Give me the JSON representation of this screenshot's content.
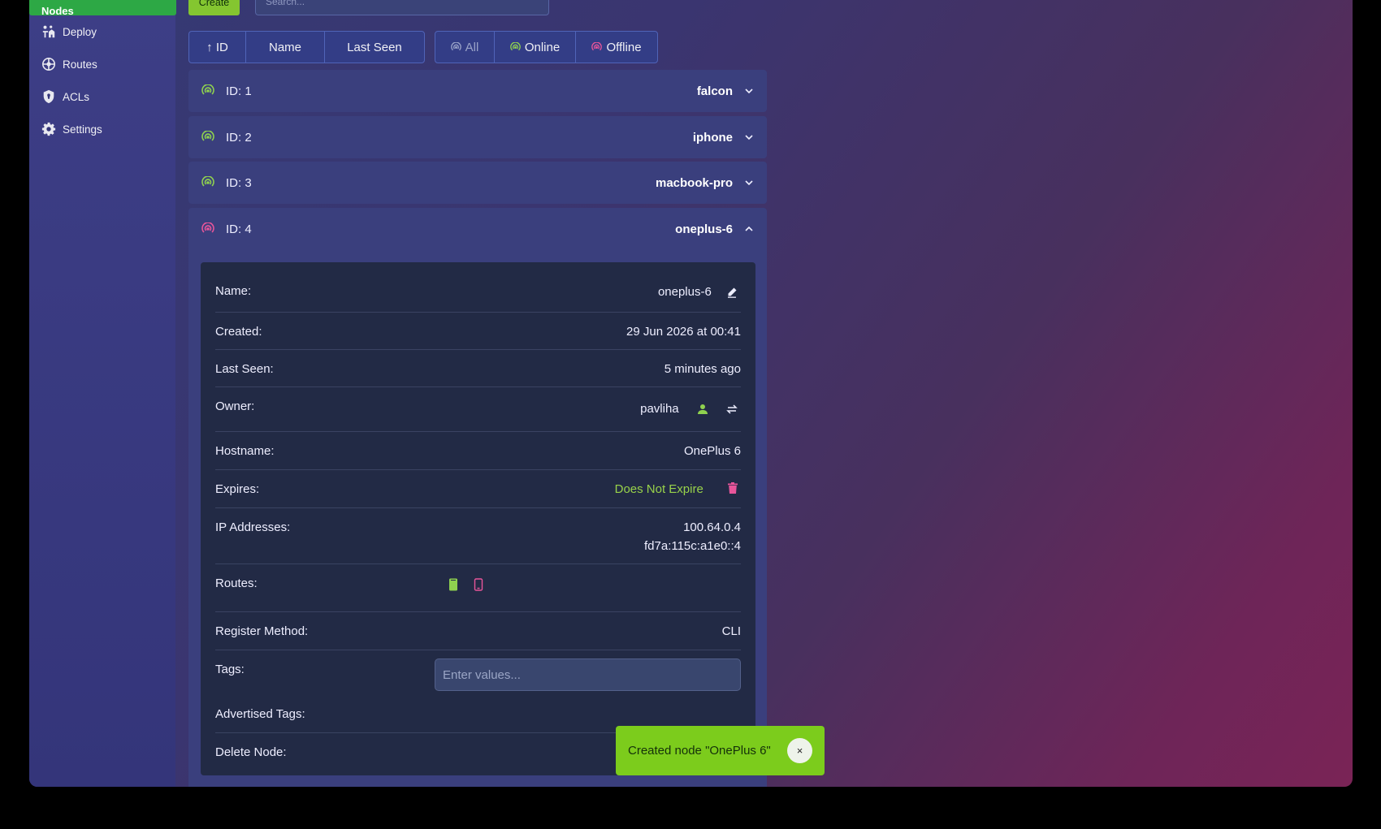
{
  "sidebar": {
    "active_label": "Nodes",
    "items": [
      {
        "label": "Deploy",
        "icon": "deploy-icon"
      },
      {
        "label": "Routes",
        "icon": "routes-icon"
      },
      {
        "label": "ACLs",
        "icon": "shield-icon"
      },
      {
        "label": "Settings",
        "icon": "gear-icon"
      }
    ]
  },
  "toolbar": {
    "create_label": "Create",
    "search_placeholder": "Search..."
  },
  "sort": {
    "id_label": "↑ ID",
    "name_label": "Name",
    "last_seen_label": "Last Seen"
  },
  "filter": {
    "all_label": "All",
    "online_label": "Online",
    "offline_label": "Offline"
  },
  "nodes": [
    {
      "id_label": "ID: 1",
      "name": "falcon",
      "status": "online"
    },
    {
      "id_label": "ID: 2",
      "name": "iphone",
      "status": "online"
    },
    {
      "id_label": "ID: 3",
      "name": "macbook-pro",
      "status": "online"
    },
    {
      "id_label": "ID: 4",
      "name": "oneplus-6",
      "status": "offline"
    }
  ],
  "details": {
    "name_label": "Name:",
    "name_value": "oneplus-6",
    "created_label": "Created:",
    "created_value": "29 Jun 2026 at 00:41",
    "last_seen_label": "Last Seen:",
    "last_seen_value": "5 minutes ago",
    "owner_label": "Owner:",
    "owner_value": "pavliha",
    "hostname_label": "Hostname:",
    "hostname_value": "OnePlus 6",
    "expires_label": "Expires:",
    "expires_value": "Does Not Expire",
    "ip_label": "IP Addresses:",
    "ip_v4": "100.64.0.4",
    "ip_v6": "fd7a:115c:a1e0::4",
    "routes_label": "Routes:",
    "register_label": "Register Method:",
    "register_value": "CLI",
    "tags_label": "Tags:",
    "tags_placeholder": "Enter values...",
    "advertised_label": "Advertised Tags:",
    "delete_label": "Delete Node:"
  },
  "toast": {
    "message": "Created node \"OnePlus 6\"",
    "close": "×"
  },
  "colors": {
    "online": "#8fd14f",
    "offline": "#e8559a",
    "accent_green": "#84c630"
  }
}
